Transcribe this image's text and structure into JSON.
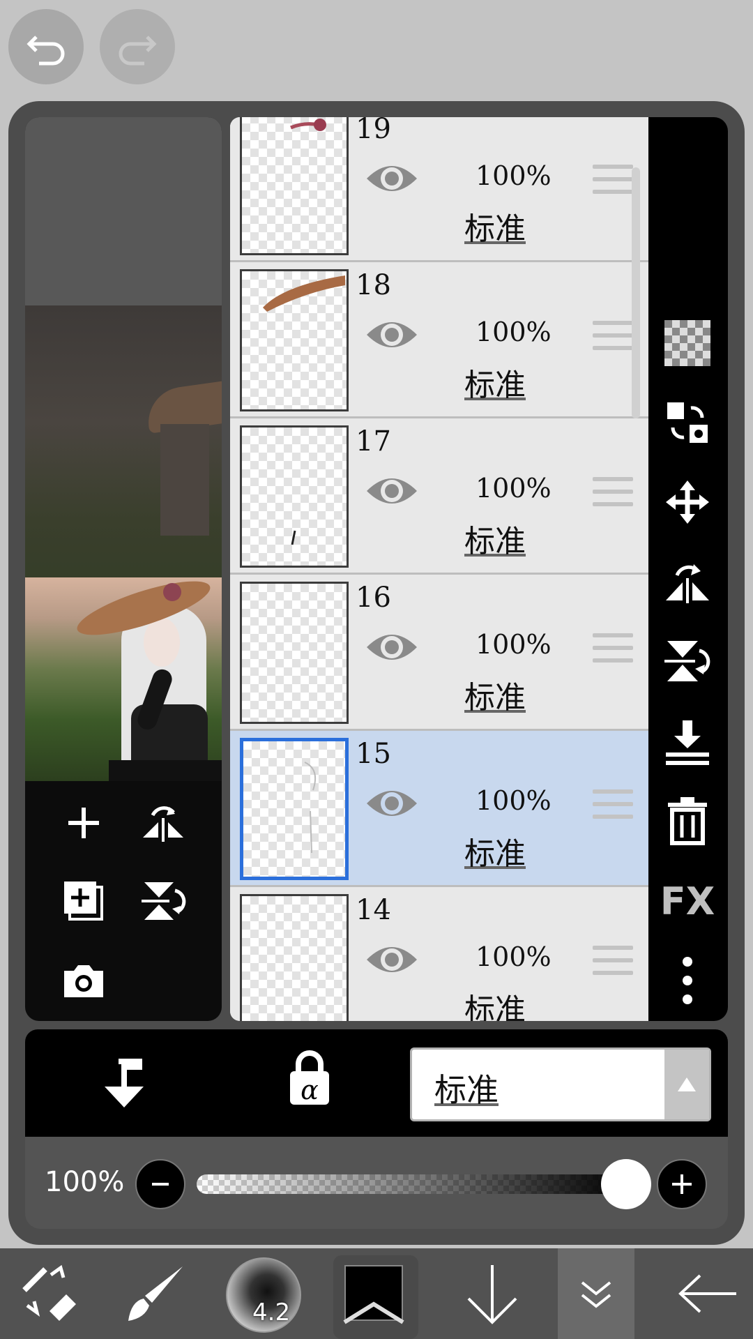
{
  "top": {
    "undo_icon": "undo-arrow-icon",
    "redo_icon": "redo-arrow-icon"
  },
  "layers": [
    {
      "num": "19",
      "opacity": "100%",
      "blend": "标准",
      "selected": false
    },
    {
      "num": "18",
      "opacity": "100%",
      "blend": "标准",
      "selected": false
    },
    {
      "num": "17",
      "opacity": "100%",
      "blend": "标准",
      "selected": false
    },
    {
      "num": "16",
      "opacity": "100%",
      "blend": "标准",
      "selected": false
    },
    {
      "num": "15",
      "opacity": "100%",
      "blend": "标准",
      "selected": true
    },
    {
      "num": "14",
      "opacity": "100%",
      "blend": "标准",
      "selected": false
    }
  ],
  "right_toolbar": {
    "fx_label": "FX"
  },
  "layer_props": {
    "blend_mode": "标准",
    "opacity_label": "100%",
    "opacity_value": 1.0
  },
  "bottom_toolbar": {
    "brush_size": "4.2",
    "color": "#000000"
  },
  "colors": {
    "accent": "#2b6fdb",
    "selected_row": "#c8d8ee"
  }
}
